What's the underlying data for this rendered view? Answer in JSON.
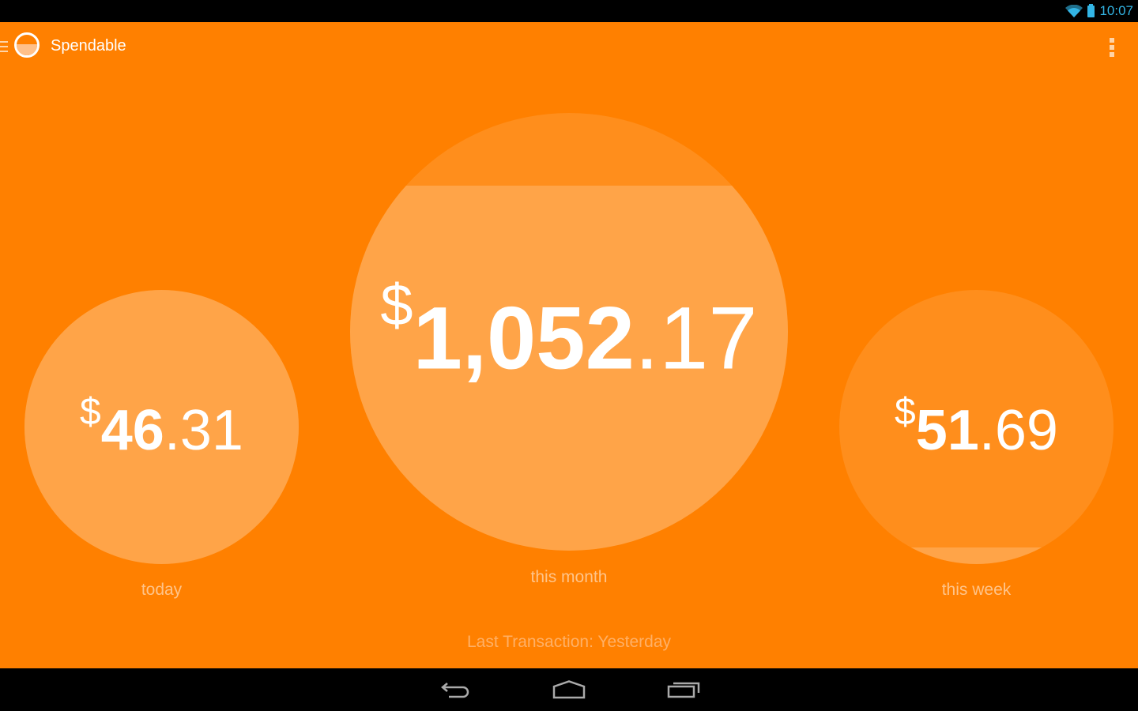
{
  "status_bar": {
    "time": "10:07",
    "icons": [
      "wifi-icon",
      "battery-icon"
    ],
    "accent_color": "#33b5e5"
  },
  "app_bar": {
    "title": "Spendable",
    "icons": [
      "drawer-icon",
      "app-logo-icon",
      "overflow-menu-icon"
    ]
  },
  "theme": {
    "background": "#ff8000",
    "gauge_empty": "#ff8e1c",
    "gauge_fill": "#ffa448",
    "text": "#ffffff",
    "label": "#ffc48a"
  },
  "gauges": {
    "today": {
      "currency": "$",
      "whole": "46",
      "cents": ".31",
      "label": "today",
      "fill_fraction": 1.0
    },
    "month": {
      "currency": "$",
      "whole": "1,052",
      "cents": ".17",
      "label": "this month",
      "fill_fraction": 0.834
    },
    "week": {
      "currency": "$",
      "whole": "51",
      "cents": ".69",
      "label": "this week",
      "fill_fraction": 0.06
    }
  },
  "footer": {
    "last_transaction": "Last Transaction: Yesterday"
  },
  "nav_bar": {
    "buttons": [
      "back-icon",
      "home-icon",
      "recents-icon"
    ]
  }
}
